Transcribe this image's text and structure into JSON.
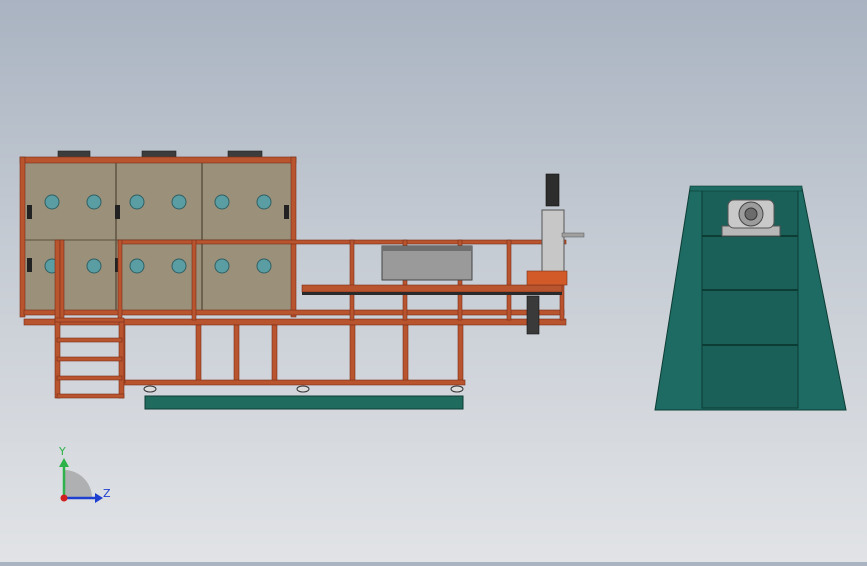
{
  "view": {
    "colors": {
      "background_top": "#a9b3c1",
      "background_bottom": "#e1e3e6",
      "frame": "#b8542e",
      "panel": "#9b9079",
      "base": "#1f6b5e",
      "housing": "#1e6b63",
      "machinery": "#9a9a9a"
    }
  },
  "triad": {
    "y_label": "Y",
    "z_label": "Z",
    "y_color": "#2db34a",
    "z_color": "#1f3fd1",
    "x_color": "#d11f1f"
  }
}
